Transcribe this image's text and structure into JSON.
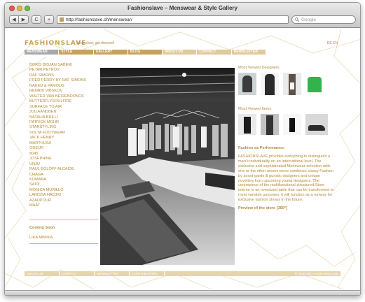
{
  "window": {
    "title": "Fashionslave – Menswear & Style Gallery"
  },
  "toolbar": {
    "back": "◀",
    "forward": "▶",
    "reload": "C",
    "add": "+",
    "url": "http://fashionslave.ch/menswear/",
    "search_placeholder": "Google"
  },
  "site": {
    "logo": "FASHIONSLAVE",
    "tagline": "Life's short, get dressed!",
    "lang": "DE EN"
  },
  "nav": [
    "MENSWEAR",
    "STYLE",
    "GALLERY",
    "BLOG",
    "ABOUT US",
    "CONTACT",
    "NEWSLETTER"
  ],
  "designers": [
    "BORIS BIDJAN SABERI",
    "PETAR PETROV",
    "RAF SIMONS",
    "FRED PERRY BY RAF SIMONS",
    "NAKED & FAMOUS",
    "HENRIK VIBSKOV",
    "WALTER VAN BEIRENDONCK",
    "BUTTERFLYSOULFIRE",
    "SURFACE TO AIR",
    "JULIAANDBEN",
    "NATALIA BRILLI",
    "PATRICK MOHR",
    "STARSTYLING",
    "VOLTA FOOTWEAR",
    "JACK HENRY",
    "MARTHUSA",
    "ODEUR",
    "8045",
    "JOSÉPHINE",
    "UNJU",
    "RAUL EGLOFF ALCAIDE",
    "CHAGA",
    "KOMANA",
    "SAIDI",
    "MONICA MURILLO",
    "LARISSA HADJIO",
    "AZADPOUR",
    "MAAT"
  ],
  "coming_soon": {
    "title": "Coming Soon",
    "items": [
      "LIKA MIMIKA"
    ]
  },
  "right": {
    "most_viewed_designers": "Most Viewed Designers",
    "most_viewed_items": "Most Viewed Items",
    "performance_title": "Fashion as Performance.",
    "body": "FASHIONSLAVE provides everything to distinguish a man's individuality on an international level. The exclusive and sophisticated Menswear-selection with one or the other unisex piece combines classy Fashion by avant-garde & puristic designers and unique novelties from upcoming young designers. The centrepiece of the multifunctional structured Store interior is an oversized table that can be transformed to meet variable purposes: it will function as a runway for exclusive fashion shows in the future.",
    "preview_link": "Preview of the store [360°]"
  },
  "footer": [
    "ABOUT US",
    "CONTACT",
    "NEWSLETTER",
    "CONTRIBUTORS"
  ],
  "copyright": "© 2010-2011 FASHIONSLAVE",
  "colors": {
    "brand": "#c8a25a",
    "text": "#b58a35",
    "nav_active": "#a8a8a8"
  },
  "icons": {
    "back": "back-arrow-icon",
    "forward": "forward-arrow-icon",
    "reload": "reload-icon",
    "add": "add-tab-icon",
    "favicon": "site-favicon-icon",
    "search": "search-icon"
  }
}
